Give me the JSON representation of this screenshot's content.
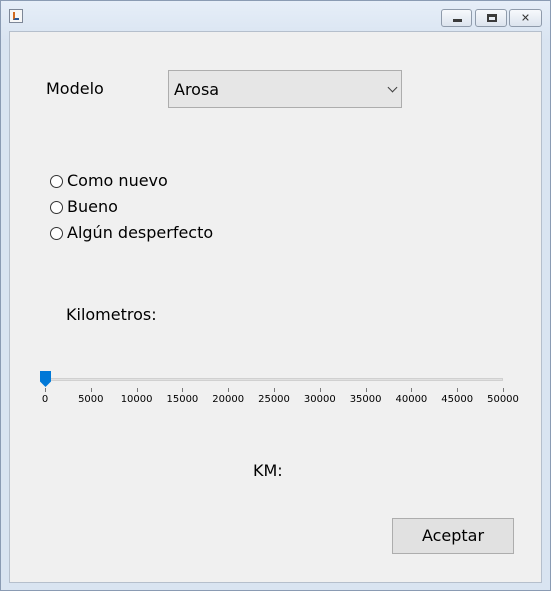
{
  "window": {
    "title": "",
    "controls": {
      "minimize": "minimize",
      "maximize": "maximize",
      "close": "close"
    }
  },
  "form": {
    "modelo_label": "Modelo",
    "modelo_value": "Arosa",
    "condition_options": [
      {
        "label": "Como nuevo",
        "selected": false
      },
      {
        "label": "Bueno",
        "selected": false
      },
      {
        "label": "Algún desperfecto",
        "selected": false
      }
    ],
    "kilometros_label": "Kilometros:",
    "slider": {
      "value": 0,
      "min": 0,
      "max": 50000,
      "ticks": [
        "0",
        "5000",
        "10000",
        "15000",
        "20000",
        "25000",
        "30000",
        "35000",
        "40000",
        "45000",
        "50000"
      ]
    },
    "km_label": "KM:",
    "km_value": "",
    "accept_button": "Aceptar"
  },
  "colors": {
    "window_background": "#f0f0f0",
    "slider_thumb": "#0078d7",
    "title_bar": "#dbe6f3"
  },
  "icons": {
    "app_icon": "java-app-icon",
    "minimize_icon": "minimize-icon",
    "maximize_icon": "maximize-icon",
    "close_icon": "close-icon"
  }
}
